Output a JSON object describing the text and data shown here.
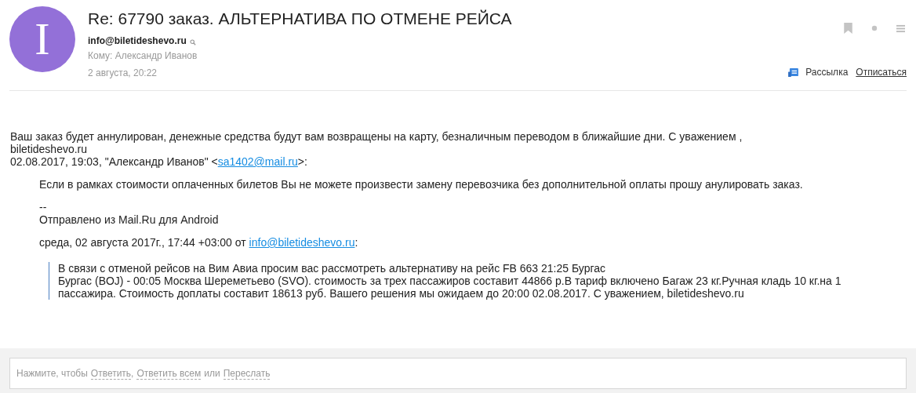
{
  "message": {
    "avatar_letter": "I",
    "subject": "Re: 67790 заказ. АЛЬТЕРНАТИВА ПО ОТМЕНЕ РЕЙСА",
    "sender": "info@biletideshevo.ru",
    "recipient": "Кому: Александр Иванов",
    "date": "2 августа, 20:22",
    "bookmarked": false,
    "read": true,
    "mailing_label": "Рассылка",
    "unsubscribe": "Отписаться"
  },
  "body": {
    "lines": [
      [
        {
          "kind": "text",
          "text": "Ваш заказ будет аннулирован, денежные средства будут вам возвращены на карту, безналичным переводом в ближайшие дни. С уважением ,"
        }
      ],
      [
        {
          "kind": "text",
          "text": "biletideshevo.ru"
        }
      ],
      [
        {
          "kind": "text",
          "text": "02.08.2017, 19:03, \"Александр Иванов\" <"
        },
        {
          "kind": "link",
          "text": "sa1402@mail.ru"
        },
        {
          "kind": "text",
          "text": ">:"
        }
      ]
    ],
    "indented": [
      [
        [
          {
            "kind": "text",
            "text": "Если в рамках стоимости оплаченных билетов Вы не можете произвести замену перевозчика без дополнительной оплаты прошу анулировать заказ."
          }
        ]
      ],
      [
        [
          {
            "kind": "text",
            "text": "--"
          }
        ],
        [
          {
            "kind": "text",
            "text": "Отправлено из Mail.Ru для Android"
          }
        ]
      ],
      [
        [
          {
            "kind": "text",
            "text": "среда, 02 августа 2017г., 17:44 +03:00 от "
          },
          {
            "kind": "link",
            "text": "info@biletideshevo.ru"
          },
          {
            "kind": "text",
            "text": ":"
          }
        ]
      ]
    ]
  },
  "quote": [
    "В связи с отменой рейсов на Вим Авиа просим вас рассмотреть альтернативу на рейс FB 663 21:25 Бургас",
    "Бургас (BOJ) - 00:05 Москва Шереметьево (SVO). стоимость за трех пассажиров составит 44866 р.В тариф включено Багаж 23 кг.Ручная кладь 10 кг.на 1",
    "пассажира. Стоимость доплаты составит 18613 руб. Вашего решения мы ожидаем до 20:00 02.08.2017. С уважением, biletideshevo.ru"
  ],
  "reply_bar": [
    {
      "kind": "text",
      "text": "Нажмите, чтобы"
    },
    {
      "kind": "link",
      "text": "Ответить"
    },
    {
      "kind": "text",
      "text": ","
    },
    {
      "kind": "link",
      "text": "Ответить всем"
    },
    {
      "kind": "text",
      "text": "или"
    },
    {
      "kind": "link",
      "text": "Переслать"
    }
  ]
}
